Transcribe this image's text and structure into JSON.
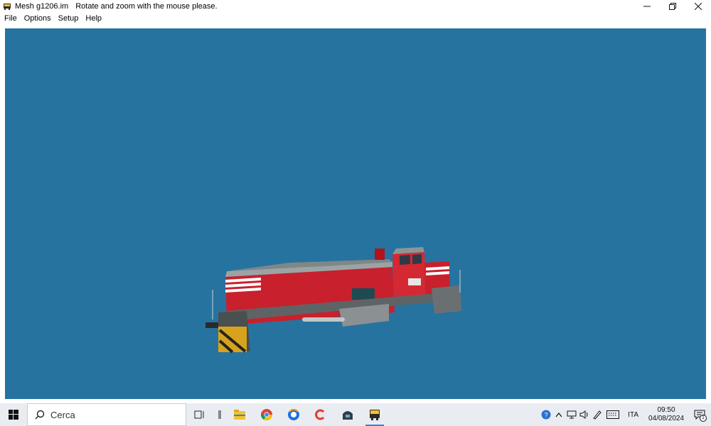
{
  "window": {
    "title": "Mesh g1206.im",
    "hint": "Rotate and zoom with the mouse please.",
    "controls": {
      "minimize": "minimize-icon",
      "restore": "restore-icon",
      "close": "close-icon"
    }
  },
  "menu": {
    "items": [
      "File",
      "Options",
      "Setup",
      "Help"
    ]
  },
  "viewport": {
    "background": "#2673a0",
    "model": "red diesel locomotive"
  },
  "taskbar": {
    "search_placeholder": "Cerca",
    "apps": [
      "task-view-icon",
      "separator-icon",
      "file-explorer-icon",
      "chrome-icon",
      "firefox-icon",
      "ccleaner-icon",
      "train-app-icon",
      "locomotive-app-icon"
    ],
    "tray": {
      "language": "ITA",
      "time": "09:50",
      "date": "04/08/2024",
      "notification_count": "1"
    }
  }
}
